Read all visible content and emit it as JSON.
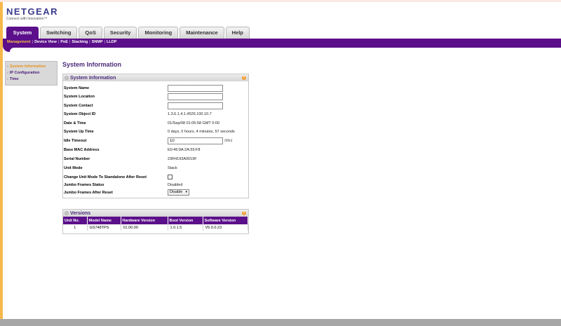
{
  "brand": {
    "name": "NETGEAR",
    "tagline": "Connect with Innovation™"
  },
  "tabs": [
    {
      "label": "System",
      "active": true
    },
    {
      "label": "Switching"
    },
    {
      "label": "QoS"
    },
    {
      "label": "Security"
    },
    {
      "label": "Monitoring"
    },
    {
      "label": "Maintenance"
    },
    {
      "label": "Help"
    }
  ],
  "subnav": [
    {
      "label": "Management",
      "active": true
    },
    {
      "label": "Device View"
    },
    {
      "label": "PoE"
    },
    {
      "label": "Stacking"
    },
    {
      "label": "SNMP"
    },
    {
      "label": "LLDP"
    }
  ],
  "sidebar": {
    "items": [
      {
        "label": "System Information",
        "active": true
      },
      {
        "label": "IP Configuration"
      },
      {
        "label": "Time"
      }
    ]
  },
  "page": {
    "title": "System Information"
  },
  "sysinfo": {
    "header": "System Information",
    "system_name": {
      "label": "System Name",
      "value": ""
    },
    "system_location": {
      "label": "System Location",
      "value": ""
    },
    "system_contact": {
      "label": "System Contact",
      "value": ""
    },
    "system_object_id": {
      "label": "System Object ID",
      "value": "1.3.6.1.4.1.4526.100.10.7"
    },
    "date_time": {
      "label": "Date & Time",
      "value": "01/Sep/08 01:05:58 GMT 0:00"
    },
    "up_time": {
      "label": "System Up Time",
      "value": "0 days, 0 hours, 4 minutes, 57 seconds"
    },
    "idle_timeout": {
      "label": "Idle Timeout",
      "value": "10",
      "unit": "(Min)"
    },
    "base_mac": {
      "label": "Base MAC Address",
      "value": "E0:46:9A:2A:55:F8"
    },
    "serial": {
      "label": "Serial Number",
      "value": "23R4193A0019F"
    },
    "unit_mode": {
      "label": "Unit Mode",
      "value": "Stack"
    },
    "change_mode": {
      "label": "Change Unit Mode To Standalone After Reset"
    },
    "jumbo_status": {
      "label": "Jumbo Frames Status",
      "value": "Disabled"
    },
    "jumbo_after_reset": {
      "label": "Jumbo Frames After Reset",
      "value": "Disable"
    }
  },
  "versions": {
    "header": "Versions",
    "columns": [
      "Unit No.",
      "Model Name",
      "Hardware Version",
      "Boot Version",
      "Software Version"
    ],
    "rows": [
      [
        "1",
        "GS748TPS",
        "01.00.00",
        "1.0.1.5",
        "V5.0.0.23"
      ]
    ]
  }
}
